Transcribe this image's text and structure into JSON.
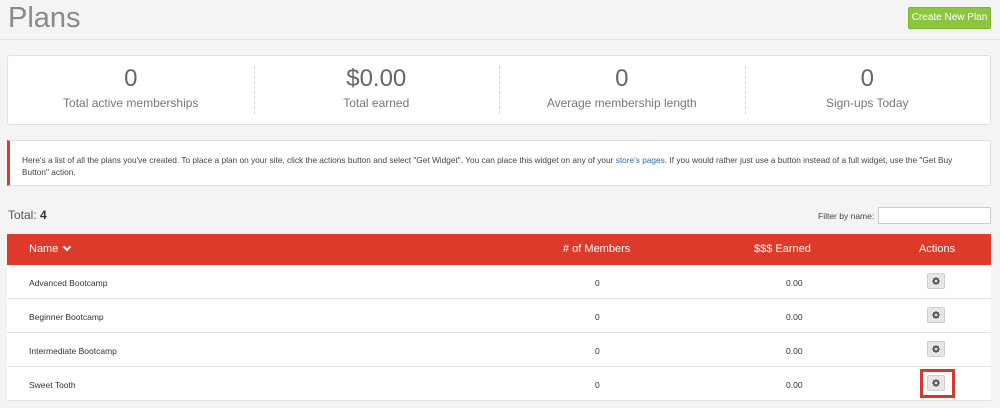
{
  "header": {
    "title": "Plans",
    "create_button": "Create New Plan"
  },
  "stats": [
    {
      "value": "0",
      "label": "Total active memberships"
    },
    {
      "value": "$0.00",
      "label": "Total earned"
    },
    {
      "value": "0",
      "label": "Average membership length"
    },
    {
      "value": "0",
      "label": "Sign-ups Today"
    }
  ],
  "notice": {
    "text_before": "Here's a list of all the plans you've created. To place a plan on your site, click the actions button and select \"Get Widget\". You can place this widget on any of your ",
    "link": "store's pages",
    "text_after": ". If you would rather just use a button instead of a full widget, use the \"Get Buy Button\" action."
  },
  "list": {
    "total_label": "Total:",
    "total_count": "4",
    "filter_label": "Filter by name:",
    "filter_value": ""
  },
  "table": {
    "headers": {
      "name": "Name",
      "members": "# of Members",
      "earned": "$$$ Earned",
      "actions": "Actions"
    },
    "rows": [
      {
        "name": "Advanced Bootcamp",
        "members": "0",
        "earned": "0.00"
      },
      {
        "name": "Beginner Bootcamp",
        "members": "0",
        "earned": "0.00"
      },
      {
        "name": "Intermediate Bootcamp",
        "members": "0",
        "earned": "0.00"
      },
      {
        "name": "Sweet Tooth",
        "members": "0",
        "earned": "0.00"
      }
    ]
  },
  "icons": {
    "sort": "chevron-down-icon",
    "action": "gear-icon"
  },
  "colors": {
    "accent": "#de3a2b",
    "create_button": "#8cc63f",
    "link": "#2c6da3",
    "highlight": "#d33a2c"
  }
}
